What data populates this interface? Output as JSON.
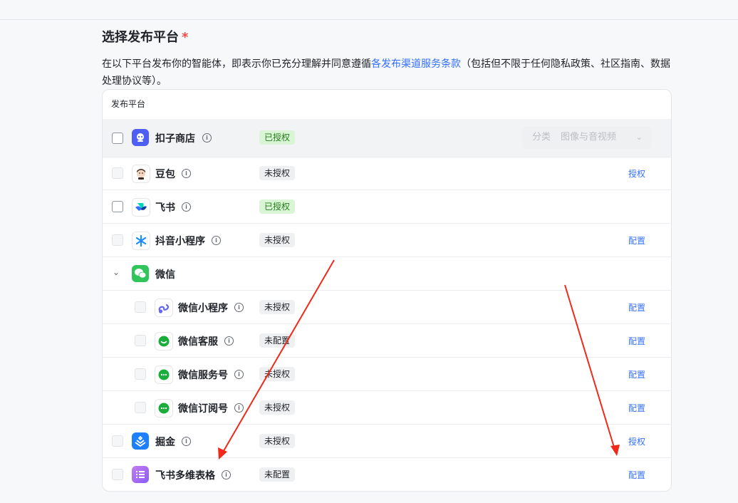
{
  "header": {
    "title": "选择发布平台",
    "required_mark": "*",
    "desc_before": "在以下平台发布你的智能体，即表示你已充分理解并同意遵循",
    "desc_link": "各发布渠道服务条款",
    "desc_after": "（包括但不限于任何隐私政策、社区指南、数据处理协议等）。"
  },
  "table": {
    "header": "发布平台",
    "rows": [
      {
        "name": "扣子商店",
        "status": "已授权",
        "status_type": "ok",
        "action": "",
        "checkbox": "active",
        "icon": "coze-store-icon",
        "category": {
          "label": "分类",
          "value": "图像与音视频"
        }
      },
      {
        "name": "豆包",
        "status": "未授权",
        "status_type": "no",
        "action": "授权",
        "checkbox": "disabled",
        "icon": "doubao-icon"
      },
      {
        "name": "飞书",
        "status": "已授权",
        "status_type": "ok",
        "action": "",
        "checkbox": "active",
        "icon": "feishu-icon"
      },
      {
        "name": "抖音小程序",
        "status": "未授权",
        "status_type": "no",
        "action": "配置",
        "checkbox": "disabled",
        "icon": "douyin-miniapp-icon"
      },
      {
        "name": "微信",
        "group": true,
        "icon": "wechat-icon"
      },
      {
        "name": "微信小程序",
        "status": "未授权",
        "status_type": "no",
        "action": "配置",
        "checkbox": "disabled",
        "icon": "wechat-miniprogram-icon",
        "child": true
      },
      {
        "name": "微信客服",
        "status": "未配置",
        "status_type": "no",
        "action": "配置",
        "checkbox": "disabled",
        "icon": "wechat-customer-service-icon",
        "child": true
      },
      {
        "name": "微信服务号",
        "status": "未授权",
        "status_type": "no",
        "action": "配置",
        "checkbox": "disabled",
        "icon": "wechat-service-account-icon",
        "child": true
      },
      {
        "name": "微信订阅号",
        "status": "未授权",
        "status_type": "no",
        "action": "配置",
        "checkbox": "disabled",
        "icon": "wechat-subscription-icon",
        "child": true
      },
      {
        "name": "掘金",
        "status": "未授权",
        "status_type": "no",
        "action": "授权",
        "checkbox": "disabled",
        "icon": "juejin-icon"
      },
      {
        "name": "飞书多维表格",
        "status": "未配置",
        "status_type": "no",
        "action": "配置",
        "checkbox": "disabled",
        "icon": "feishu-bitable-icon"
      }
    ]
  },
  "colors": {
    "accent": "#3370ff",
    "annotation_arrow": "#f02a1a",
    "authorized_bg": "#d9f5d6",
    "authorized_text": "#237b19"
  }
}
